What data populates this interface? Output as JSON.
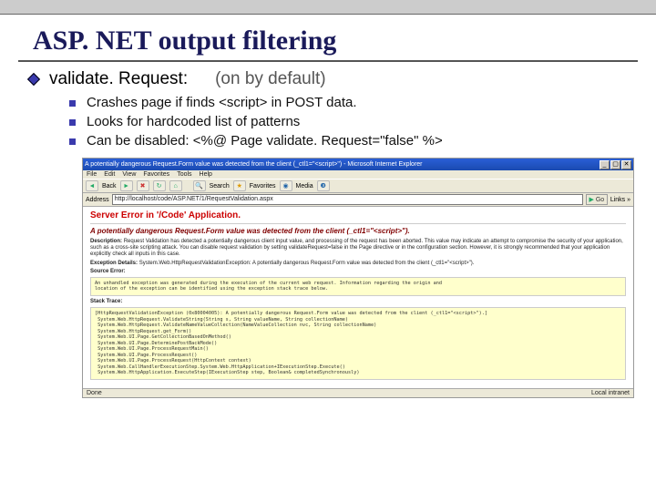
{
  "title": "ASP. NET output filtering",
  "bullet_main": {
    "label": "validate. Request:",
    "note": "(on by default)"
  },
  "sub_bullets": [
    {
      "text": "Crashes page if finds  <script>  in POST data."
    },
    {
      "text": "Looks for hardcoded list of patterns"
    },
    {
      "text": "Can be disabled:  <%@  Page  validate. Request=\"false\"  %>"
    }
  ],
  "browser": {
    "window_title": "A potentially dangerous Request.Form value was detected from the client (_ctl1=\"<script>\") - Microsoft Internet Explorer",
    "menu": [
      "File",
      "Edit",
      "View",
      "Favorites",
      "Tools",
      "Help"
    ],
    "toolbar": [
      "Back",
      "Forward",
      "Stop",
      "Refresh",
      "Home",
      "Search",
      "Favorites",
      "Media",
      "History"
    ],
    "address_label": "Address",
    "address": "http://localhost/code/ASP.NET/1/RequestValidation.aspx",
    "go_label": "Go",
    "links_label": "Links »",
    "status_left": "Done",
    "status_right": "Local intranet"
  },
  "error_page": {
    "heading": "Server Error in '/Code' Application.",
    "message": "A potentially dangerous Request.Form value was detected from the client (_ctl1=\"<script>\").",
    "description_label": "Description:",
    "description": "Request Validation has detected a potentially dangerous client input value, and processing of the request has been aborted. This value may indicate an attempt to compromise the security of your application, such as a cross-site scripting attack. You can disable request validation by setting validateRequest=false in the Page directive or in the configuration section. However, it is strongly recommended that your application explicitly check all inputs in this case.",
    "exception_label": "Exception Details:",
    "exception": "System.Web.HttpRequestValidationException: A potentially dangerous Request.Form value was detected from the client (_ctl1=\"<script>\").",
    "source_label": "Source Error:",
    "source_box": "An unhandled exception was generated during the execution of the current web request. Information regarding the origin and\nlocation of the exception can be identified using the exception stack trace below.",
    "stack_label": "Stack Trace:",
    "stack_box": "[HttpRequestValidationException (0x80004005): A potentially dangerous Request.Form value was detected from the client (_ctl1=\"<script>\").]\n System.Web.HttpRequest.ValidateString(String s, String valueName, String collectionName)\n System.Web.HttpRequest.ValidateNameValueCollection(NameValueCollection nvc, String collectionName)\n System.Web.HttpRequest.get_Form()\n System.Web.UI.Page.GetCollectionBasedOnMethod()\n System.Web.UI.Page.DeterminePostBackMode()\n System.Web.UI.Page.ProcessRequestMain()\n System.Web.UI.Page.ProcessRequest()\n System.Web.UI.Page.ProcessRequest(HttpContext context)\n System.Web.CallHandlerExecutionStep.System.Web.HttpApplication+IExecutionStep.Execute()\n System.Web.HttpApplication.ExecuteStep(IExecutionStep step, Boolean& completedSynchronously)"
  }
}
